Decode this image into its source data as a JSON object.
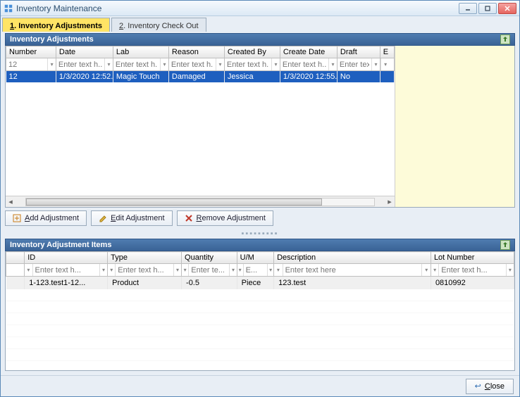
{
  "window": {
    "title": "Inventory Maintenance"
  },
  "tabs": [
    {
      "num": "1",
      "label": "Inventory Adjustments",
      "active": true
    },
    {
      "num": "2",
      "label": "Inventory Check Out",
      "active": false
    }
  ],
  "panel1": {
    "title": "Inventory Adjustments",
    "columns": [
      "Number",
      "Date",
      "Lab",
      "Reason",
      "Created By",
      "Create Date",
      "Draft",
      "E"
    ],
    "filterPlaceholders": [
      "12",
      "Enter text h...",
      "Enter text h...",
      "Enter text h...",
      "Enter text h...",
      "Enter text h...",
      "Enter text h...",
      ""
    ],
    "rows": [
      {
        "number": "12",
        "date": "1/3/2020 12:52...",
        "lab": "Magic Touch",
        "reason": "Damaged",
        "createdBy": "Jessica",
        "createDate": "1/3/2020 12:55...",
        "draft": "No",
        "extra": ""
      }
    ]
  },
  "toolbar": {
    "add": "Add Adjustment",
    "edit": "Edit Adjustment",
    "remove": "Remove Adjustment"
  },
  "panel2": {
    "title": "Inventory Adjustment Items",
    "columns": [
      "ID",
      "Type",
      "Quantity",
      "U/M",
      "Description",
      "Lot Number"
    ],
    "filterPlaceholders": [
      "Enter text h...",
      "Enter text h...",
      "Enter te...",
      "E...",
      "Enter text here",
      "Enter text h..."
    ],
    "rows": [
      {
        "id": "1-123.test1-12...",
        "type": "Product",
        "quantity": "-0.5",
        "um": "Piece",
        "description": "123.test",
        "lot": "0810992"
      }
    ]
  },
  "footer": {
    "close": "Close"
  }
}
